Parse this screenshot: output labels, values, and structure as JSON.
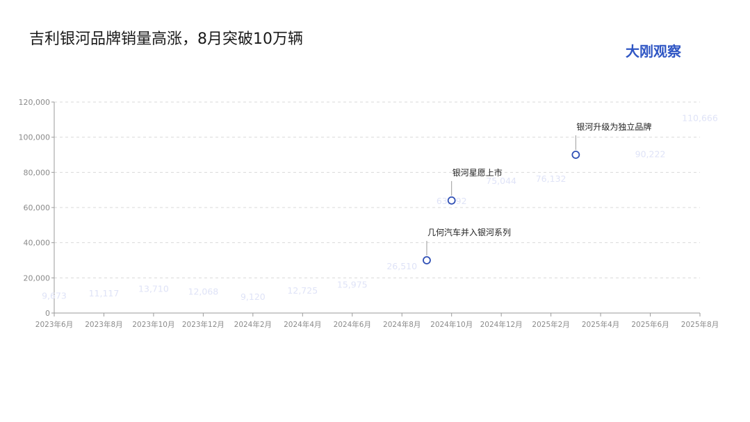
{
  "page": {
    "title": "吉利银河品牌销量高涨，8月突破10万辆",
    "brand": "大刚观察",
    "brand_color": "#2f56c4"
  },
  "chart_data": {
    "type": "line",
    "title": "吉利银河品牌销量高涨，8月突破10万辆",
    "xlabel": "",
    "ylabel": "",
    "ylim": [
      0,
      120000
    ],
    "yticks": [
      0,
      20000,
      40000,
      60000,
      80000,
      100000,
      120000
    ],
    "ytick_labels": [
      "0",
      "20,000",
      "40,000",
      "60,000",
      "80,000",
      "100,000",
      "120,000"
    ],
    "x_tick_labels": [
      "2023年6月",
      "2023年8月",
      "2023年10月",
      "2023年12月",
      "2024年2月",
      "2024年4月",
      "2024年6月",
      "2024年8月",
      "2024年10月",
      "2024年12月",
      "2025年2月",
      "2025年4月",
      "2025年6月",
      "2025年8月"
    ],
    "grid": "horizontal dashed",
    "series": [
      {
        "color": "#dfe3f7",
        "points": [
          {
            "x": "2023-06",
            "y": 9673,
            "label": "9,673"
          },
          {
            "x": "2023-08",
            "y": 11117,
            "label": "11,117"
          },
          {
            "x": "2023-10",
            "y": 13710,
            "label": "13,710"
          },
          {
            "x": "2023-12",
            "y": 12068,
            "label": "12,068"
          },
          {
            "x": "2024-02",
            "y": 9120,
            "label": "9,120"
          },
          {
            "x": "2024-04",
            "y": 12725,
            "label": "12,725"
          },
          {
            "x": "2024-06",
            "y": 15975,
            "label": "15,975"
          },
          {
            "x": "2024-08",
            "y": 26510,
            "label": "26,510"
          },
          {
            "x": "2024-10",
            "y": 63492,
            "label": "63,492"
          },
          {
            "x": "2024-12",
            "y": 75044,
            "label": "75,044"
          },
          {
            "x": "2025-02",
            "y": 76132,
            "label": "76,132"
          },
          {
            "x": "2025-06",
            "y": 90222,
            "label": "90,222"
          },
          {
            "x": "2025-08",
            "y": 110666,
            "label": "110,666"
          }
        ]
      }
    ],
    "annotations": [
      {
        "x": "2024-09",
        "y": 30000,
        "text": "几何汽车并入银河系列"
      },
      {
        "x": "2024-10",
        "y": 64000,
        "text": "银河星愿上市"
      },
      {
        "x": "2025-03",
        "y": 90000,
        "text": "银河升级为独立品牌"
      }
    ],
    "marker_color": "#2f4fb5"
  }
}
